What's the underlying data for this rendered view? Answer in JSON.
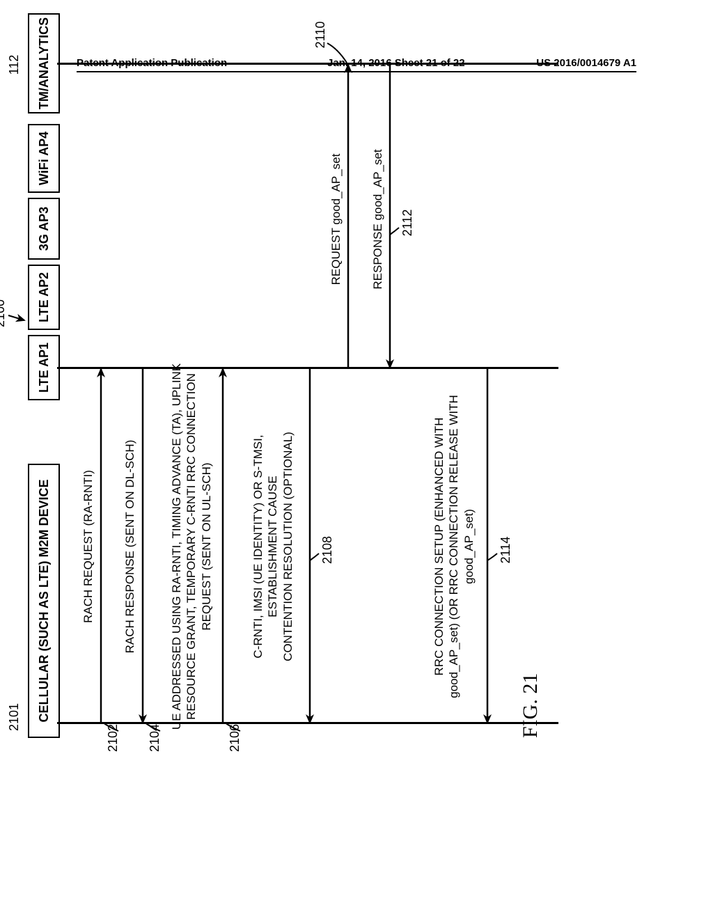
{
  "header": {
    "left": "Patent Application Publication",
    "mid": "Jan. 14, 2016  Sheet 21 of 22",
    "right": "US 2016/0014679 A1"
  },
  "figure_caption": "FIG. 21",
  "diagram_tag_main": "2100",
  "entities": {
    "m2m": {
      "label": "CELLULAR (SUCH AS LTE) M2M DEVICE",
      "tag": "2101"
    },
    "ap1": {
      "label": "LTE AP1"
    },
    "ap2": {
      "label": "LTE AP2"
    },
    "ap3": {
      "label": "3G AP3"
    },
    "ap4": {
      "label": "WiFi AP4"
    },
    "tm": {
      "label": "TM/ANALYTICS",
      "tag": "112"
    }
  },
  "messages": {
    "m2102": {
      "text": "RACH REQUEST (RA-RNTI)",
      "tag": "2102"
    },
    "m2104": {
      "text": "RACH RESPONSE (SENT ON DL-SCH)",
      "tag": "2104"
    },
    "m2106": {
      "text": "UE ADDRESSED USING RA-RNTI, TIMING ADVANCE (TA), UPLINK RESOURCE GRANT, TEMPORARY C-RNTI RRC CONNECTION REQUEST (SENT ON UL-SCH)",
      "tag": "2106"
    },
    "m2108": {
      "text": "C-RNTI, IMSI (UE IDENTITY) OR S-TMSI, ESTABLISHMENT CAUSE\nCONTENTION RESOLUTION (OPTIONAL)",
      "tag": "2108"
    },
    "m2110": {
      "text": "REQUEST good_AP_set",
      "tag": "2110"
    },
    "m2112": {
      "text": "RESPONSE good_AP_set",
      "tag": "2112"
    },
    "m2114": {
      "text": "RRC CONNECTION SETUP (ENHANCED WITH good_AP_set) (OR RRC CONNECTION RELEASE WITH good_AP_set)",
      "tag": "2114"
    }
  }
}
